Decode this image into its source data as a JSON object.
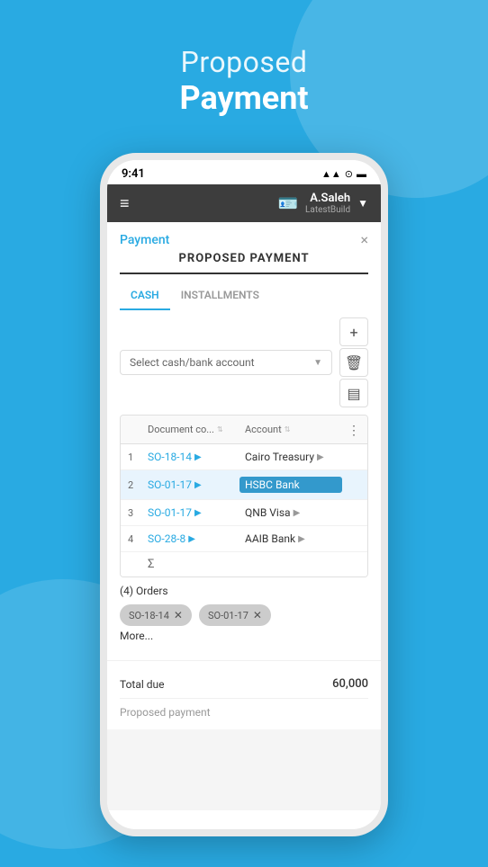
{
  "page": {
    "background_color": "#29aae2",
    "header": {
      "proposed": "Proposed",
      "payment": "Payment"
    }
  },
  "status_bar": {
    "time": "9:41",
    "icons": "▲▲ ⓦ ▬"
  },
  "app_header": {
    "user_name": "A.Saleh",
    "build_label": "LatestBuild",
    "hamburger": "≡"
  },
  "card": {
    "payment_label": "Payment",
    "close_icon": "×",
    "proposed_payment_title": "PROPOSED PAYMENT"
  },
  "tabs": [
    {
      "label": "CASH",
      "active": true
    },
    {
      "label": "INSTALLMENTS",
      "active": false
    }
  ],
  "toolbar": {
    "select_placeholder": "Select cash/bank account",
    "add_icon": "+",
    "delete_icon": "🗑",
    "filter_icon": "▤"
  },
  "table": {
    "columns": [
      {
        "label": "Document co..."
      },
      {
        "label": "Account"
      }
    ],
    "rows": [
      {
        "num": "1",
        "doc": "SO-18-14",
        "account": "Cairo Treasury",
        "selected": false
      },
      {
        "num": "2",
        "doc": "SO-01-17",
        "account": "HSBC Bank",
        "selected": true
      },
      {
        "num": "3",
        "doc": "SO-01-17",
        "account": "QNB Visa",
        "selected": false
      },
      {
        "num": "4",
        "doc": "SO-28-8",
        "account": "AAIB Bank",
        "selected": false
      }
    ],
    "sigma": "Σ"
  },
  "orders": {
    "count_label": "(4) Orders",
    "tags": [
      {
        "label": "SO-18-14"
      },
      {
        "label": "SO-01-17"
      }
    ],
    "more_link": "More..."
  },
  "totals": {
    "total_due_label": "Total due",
    "total_due_value": "60,000",
    "proposed_payment_label": "Proposed payment"
  }
}
